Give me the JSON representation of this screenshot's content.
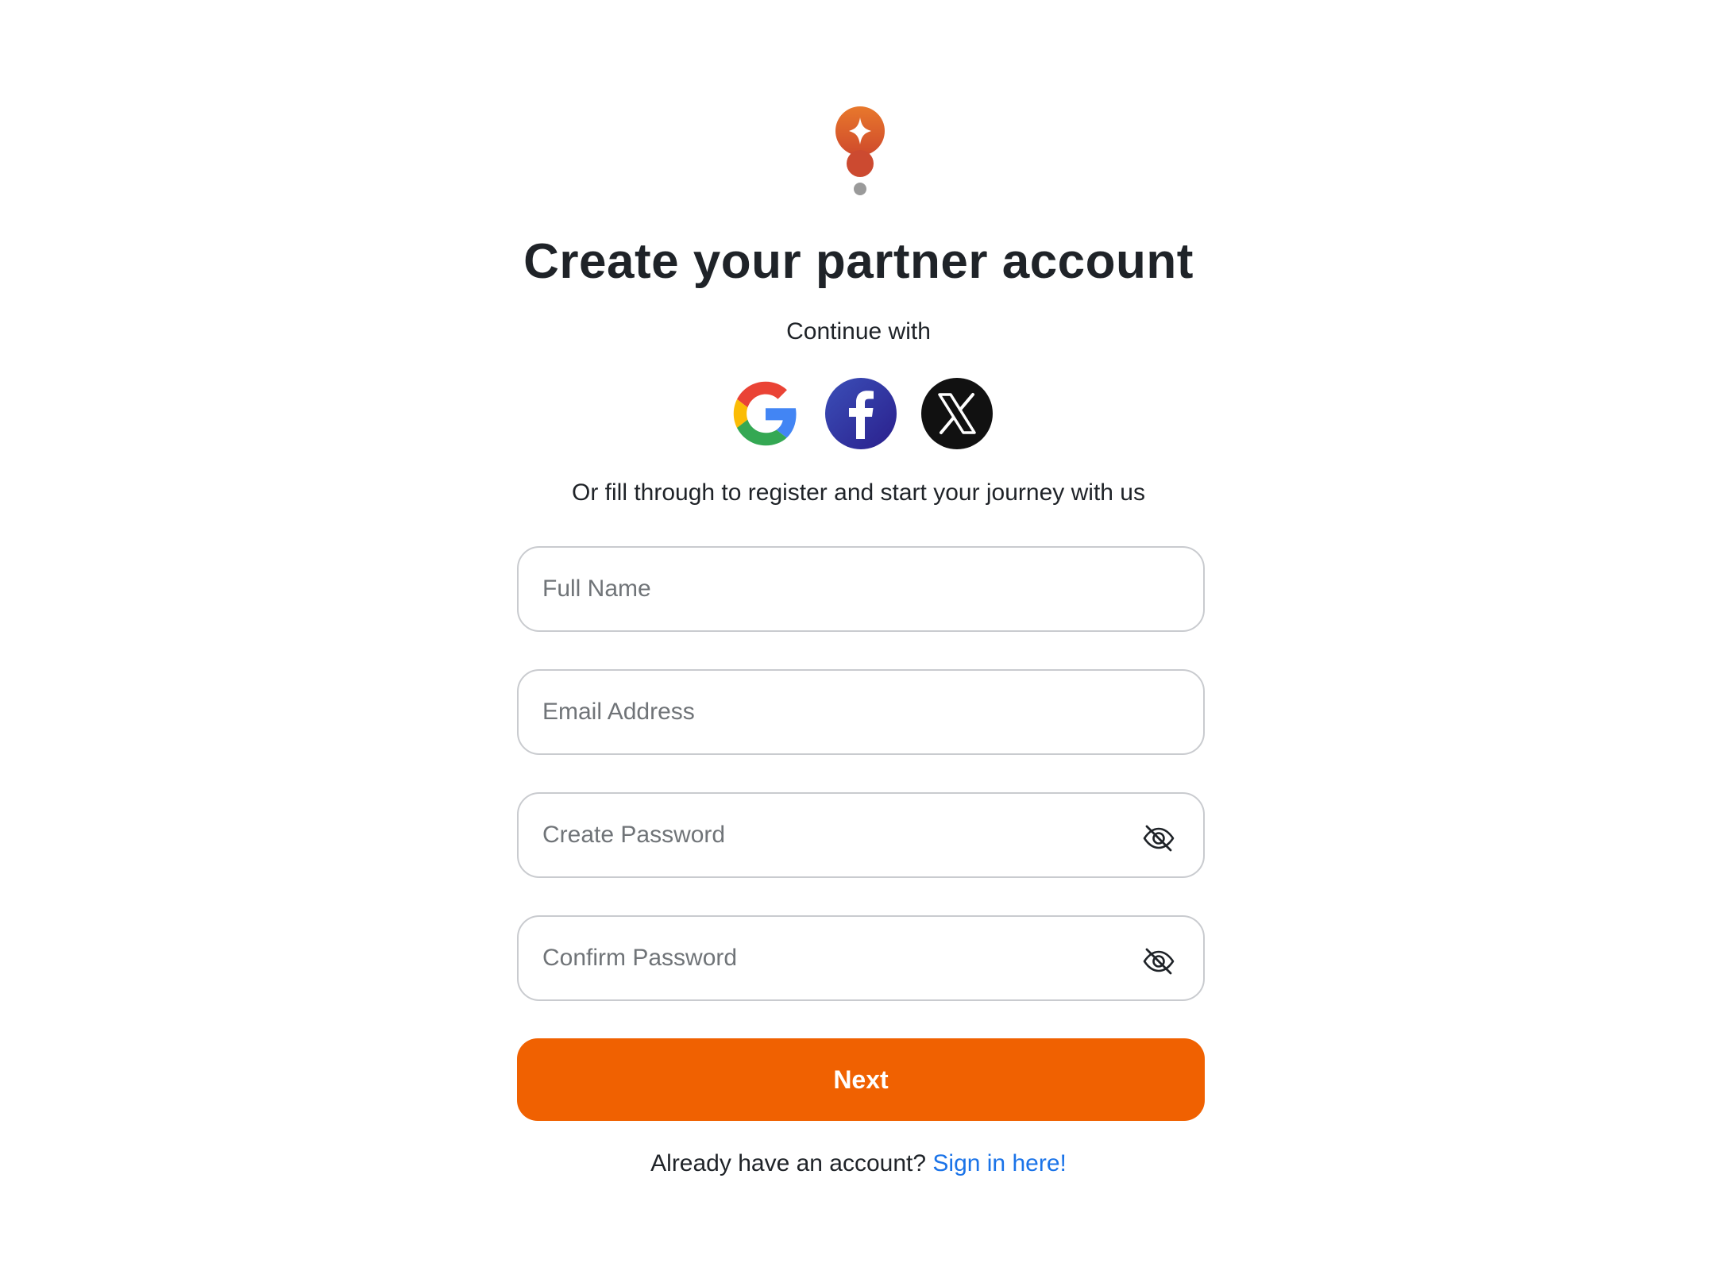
{
  "header": {
    "logo_icon": "sparkle-pin-logo-icon",
    "title": "Create your partner account"
  },
  "social": {
    "label": "Continue with",
    "providers": [
      {
        "name": "Google",
        "icon": "google-icon"
      },
      {
        "name": "Facebook",
        "icon": "facebook-icon"
      },
      {
        "name": "X",
        "icon": "x-icon"
      }
    ]
  },
  "form": {
    "subtitle": "Or fill through to register and start your journey with us",
    "full_name": {
      "placeholder": "Full Name",
      "value": ""
    },
    "email": {
      "placeholder": "Email Address",
      "value": ""
    },
    "password": {
      "placeholder": "Create Password",
      "value": "",
      "toggle_icon": "eye-off-icon"
    },
    "confirm_password": {
      "placeholder": "Confirm Password",
      "value": "",
      "toggle_icon": "eye-off-icon"
    },
    "submit_label": "Next"
  },
  "footer": {
    "prompt": "Already have an account?",
    "link_label": "Sign in here!"
  },
  "colors": {
    "primary": "#f06101",
    "link": "#1a73e8",
    "text": "#1f2328",
    "border": "#c9cbcf"
  }
}
